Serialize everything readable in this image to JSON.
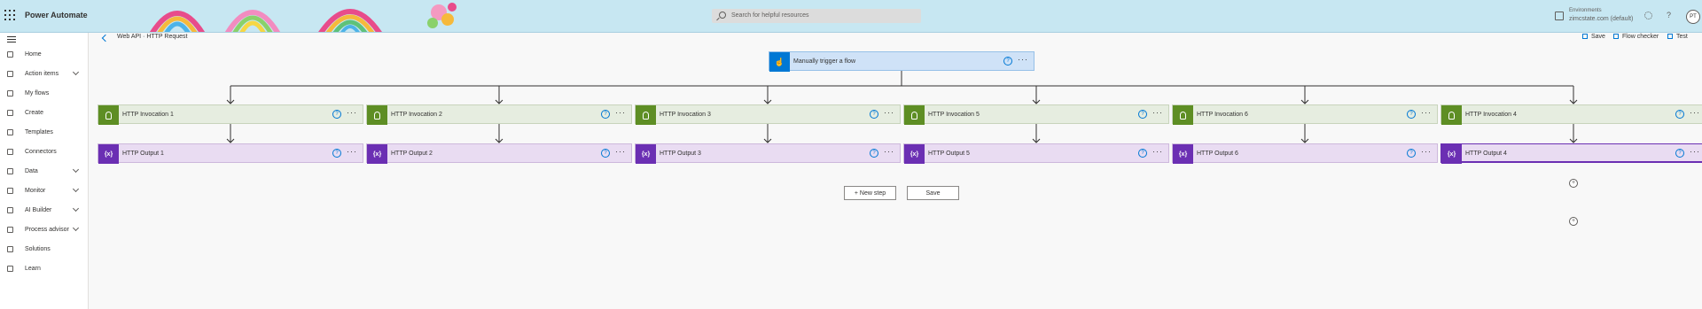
{
  "app": {
    "title": "Power Automate"
  },
  "search": {
    "placeholder": "Search for helpful resources"
  },
  "environment": {
    "label": "Environments",
    "value": "zimcstate.com (default)"
  },
  "account": {
    "initials": "PT"
  },
  "sidebar": {
    "items": [
      {
        "label": "Home",
        "icon": "home-icon",
        "chevron": false
      },
      {
        "label": "Action items",
        "icon": "clipboard-icon",
        "chevron": true
      },
      {
        "label": "My flows",
        "icon": "flow-icon",
        "chevron": false
      },
      {
        "label": "Create",
        "icon": "plus-icon",
        "chevron": false
      },
      {
        "label": "Templates",
        "icon": "template-icon",
        "chevron": false
      },
      {
        "label": "Connectors",
        "icon": "connector-icon",
        "chevron": false
      },
      {
        "label": "Data",
        "icon": "database-icon",
        "chevron": true
      },
      {
        "label": "Monitor",
        "icon": "monitor-icon",
        "chevron": true
      },
      {
        "label": "AI Builder",
        "icon": "ai-icon",
        "chevron": true
      },
      {
        "label": "Process advisor",
        "icon": "process-icon",
        "chevron": true
      },
      {
        "label": "Solutions",
        "icon": "solutions-icon",
        "chevron": false
      },
      {
        "label": "Learn",
        "icon": "book-icon",
        "chevron": false
      }
    ]
  },
  "breadcrumb": {
    "text": "Web API · HTTP Request"
  },
  "commands": {
    "save": "Save",
    "flow_checker": "Flow checker",
    "test": "Test"
  },
  "flow": {
    "trigger": {
      "title": "Manually trigger a flow",
      "icon": "touch-icon"
    },
    "columns": [
      {
        "invocation": "HTTP Invocation 1",
        "output": "HTTP Output 1"
      },
      {
        "invocation": "HTTP Invocation 2",
        "output": "HTTP Output 2"
      },
      {
        "invocation": "HTTP Invocation 3",
        "output": "HTTP Output 3"
      },
      {
        "invocation": "HTTP Invocation 5",
        "output": "HTTP Output 5"
      },
      {
        "invocation": "HTTP Invocation 6",
        "output": "HTTP Output 6"
      },
      {
        "invocation": "HTTP Invocation 4",
        "output": "HTTP Output 4"
      }
    ],
    "variable_badge": "{x}",
    "more_label": "···",
    "help_label": "?",
    "plus_label": "+"
  },
  "footer_buttons": {
    "new_step": "+ New step",
    "save": "Save"
  },
  "colors": {
    "topbar": "#c7e7f2",
    "trigger_badge": "#0078d4",
    "invoke_badge": "#5e8e24",
    "output_badge": "#6b2fb3"
  }
}
